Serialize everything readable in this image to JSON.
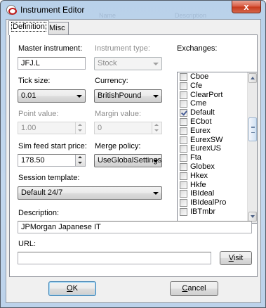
{
  "window": {
    "title": "Instrument Editor",
    "close_glyph": "x"
  },
  "background_ghost": {
    "col1": "Name",
    "col2": "Description"
  },
  "tabs": [
    {
      "label": "Definition",
      "active": true
    },
    {
      "label": "Misc",
      "active": false
    }
  ],
  "form": {
    "master_instrument": {
      "label": "Master instrument:",
      "value": "JFJ.L"
    },
    "instrument_type": {
      "label": "Instrument type:",
      "value": "Stock",
      "enabled": false
    },
    "tick_size": {
      "label": "Tick size:",
      "value": "0.01"
    },
    "currency": {
      "label": "Currency:",
      "value": "BritishPound"
    },
    "point_value": {
      "label": "Point value:",
      "value": "1.00",
      "enabled": false
    },
    "margin_value": {
      "label": "Margin value:",
      "value": "0",
      "enabled": false
    },
    "sim_feed_start_price": {
      "label": "Sim feed start price:",
      "value": "178.50"
    },
    "merge_policy": {
      "label": "Merge policy:",
      "value": "UseGlobalSettings"
    },
    "session_template": {
      "label": "Session template:",
      "value": "Default 24/7"
    },
    "description": {
      "label": "Description:",
      "value": "JPMorgan Japanese IT"
    },
    "url": {
      "label": "URL:",
      "value": ""
    }
  },
  "exchanges": {
    "label": "Exchanges:",
    "items": [
      {
        "label": "Cboe",
        "checked": false
      },
      {
        "label": "Cfe",
        "checked": false
      },
      {
        "label": "ClearPort",
        "checked": false
      },
      {
        "label": "Cme",
        "checked": false
      },
      {
        "label": "Default",
        "checked": true
      },
      {
        "label": "ECbot",
        "checked": false
      },
      {
        "label": "Eurex",
        "checked": false
      },
      {
        "label": "EurexSW",
        "checked": false
      },
      {
        "label": "EurexUS",
        "checked": false
      },
      {
        "label": "Fta",
        "checked": false
      },
      {
        "label": "Globex",
        "checked": false
      },
      {
        "label": "Hkex",
        "checked": false
      },
      {
        "label": "Hkfe",
        "checked": false
      },
      {
        "label": "IBIdeal",
        "checked": false
      },
      {
        "label": "IBIdealPro",
        "checked": false
      },
      {
        "label": "IBTmbr",
        "checked": false
      }
    ]
  },
  "buttons": {
    "visit": {
      "prefix": "",
      "mnemonic": "V",
      "suffix": "isit"
    },
    "ok": {
      "prefix": "",
      "mnemonic": "O",
      "suffix": "K"
    },
    "cancel": {
      "prefix": "",
      "mnemonic": "C",
      "suffix": "ancel"
    }
  },
  "colors": {
    "title_gradient": "#b9d1ea",
    "close_button": "#c7381a",
    "checkmark": "#4a5f97"
  }
}
